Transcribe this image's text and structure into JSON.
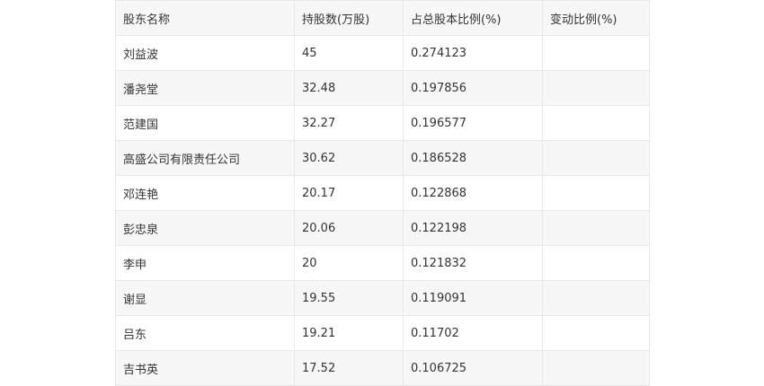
{
  "table": {
    "headers": [
      "股东名称",
      "持股数(万股)",
      "占总股本比例(%)",
      "变动比例(%)"
    ],
    "rows": [
      [
        "刘益波",
        "45",
        "0.274123",
        ""
      ],
      [
        "潘尧堂",
        "32.48",
        "0.197856",
        ""
      ],
      [
        "范建国",
        "32.27",
        "0.196577",
        ""
      ],
      [
        "高盛公司有限责任公司",
        "30.62",
        "0.186528",
        ""
      ],
      [
        "邓连艳",
        "20.17",
        "0.122868",
        ""
      ],
      [
        "彭忠泉",
        "20.06",
        "0.122198",
        ""
      ],
      [
        "李申",
        "20",
        "0.121832",
        ""
      ],
      [
        "谢显",
        "19.55",
        "0.119091",
        ""
      ],
      [
        "吕东",
        "19.21",
        "0.11702",
        ""
      ],
      [
        "吉书英",
        "17.52",
        "0.106725",
        ""
      ]
    ]
  }
}
